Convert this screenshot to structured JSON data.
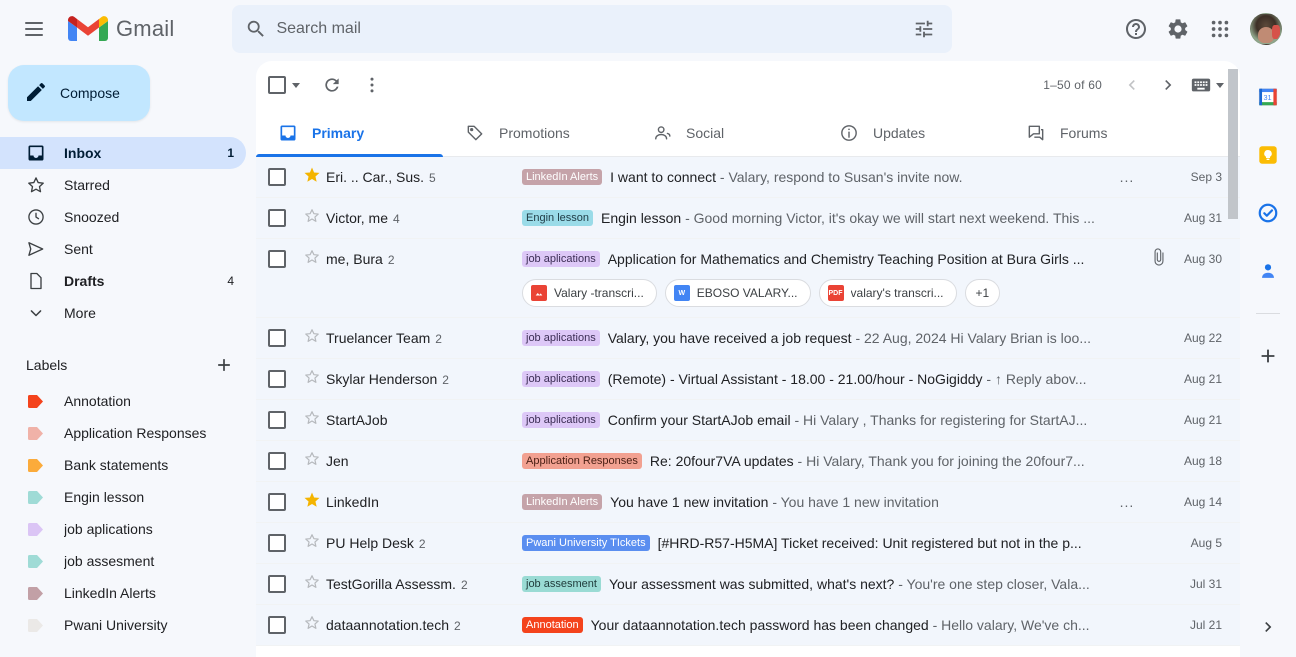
{
  "header": {
    "menu_icon": "hamburger-menu-icon",
    "brand": "Gmail",
    "search": {
      "placeholder": "Search mail",
      "value": "",
      "search_icon": "search-icon",
      "options_icon": "search-options-icon"
    },
    "support_icon": "help-icon",
    "settings_icon": "gear-icon",
    "apps_icon": "google-apps-grid-icon",
    "avatar_icon": "user-avatar"
  },
  "sidebar": {
    "compose": {
      "label": "Compose",
      "icon": "pencil-icon"
    },
    "items": [
      {
        "label": "Inbox",
        "icon": "inbox-icon",
        "count": "1",
        "active": true
      },
      {
        "label": "Starred",
        "icon": "star-icon",
        "count": "",
        "active": false
      },
      {
        "label": "Snoozed",
        "icon": "clock-icon",
        "count": "",
        "active": false
      },
      {
        "label": "Sent",
        "icon": "send-icon",
        "count": "",
        "active": false
      },
      {
        "label": "Drafts",
        "icon": "draft-file-icon",
        "count": "4",
        "active": false
      },
      {
        "label": "More",
        "icon": "chevron-down-icon",
        "count": "",
        "active": false
      }
    ],
    "labels_title": "Labels",
    "create_label_icon": "plus-icon",
    "labels": [
      {
        "label": "Annotation",
        "color": "#f4431c"
      },
      {
        "label": "Application Responses",
        "color": "#f0b2a8"
      },
      {
        "label": "Bank statements",
        "color": "#fbab3b"
      },
      {
        "label": "Engin lesson",
        "color": "#9fdbd6"
      },
      {
        "label": "job aplications",
        "color": "#dbc5f5"
      },
      {
        "label": "job assesment",
        "color": "#9fdbd6"
      },
      {
        "label": "LinkedIn Alerts",
        "color": "#c2a0a6"
      },
      {
        "label": "Pwani University",
        "color": "#ebe9e7"
      }
    ]
  },
  "toolbar": {
    "select_all_icon": "select-all-checkbox",
    "select_dropdown_icon": "chevron-down-icon",
    "refresh_icon": "refresh-icon",
    "more_icon": "more-vertical-icon",
    "page_range": "1–50 of 60",
    "prev_icon": "chevron-left-icon",
    "next_icon": "chevron-right-icon",
    "input_tools_icon": "keyboard-icon",
    "input_tools_caret": "chevron-down-icon"
  },
  "tabs": [
    {
      "label": "Primary",
      "icon": "inbox-tab-icon",
      "active": true
    },
    {
      "label": "Promotions",
      "icon": "tag-icon",
      "active": false
    },
    {
      "label": "Social",
      "icon": "people-icon",
      "active": false
    },
    {
      "label": "Updates",
      "icon": "info-icon",
      "active": false
    },
    {
      "label": "Forums",
      "icon": "forum-icon",
      "active": false
    }
  ],
  "emails": [
    {
      "sender": "Eri. .. Car., Sus.",
      "count": "5",
      "starred": true,
      "label": "LinkedIn Alerts",
      "label_bg": "#c5a3a9",
      "label_fg": "#ffffff",
      "subject": "I want to connect",
      "snippet": "- Valary, respond to Susan's invite now.",
      "ellipsis": "...",
      "attachment": false,
      "date": "Sep 3",
      "attachments": []
    },
    {
      "sender": "Victor, me",
      "count": "4",
      "starred": false,
      "label": "Engin lesson",
      "label_bg": "#9adbe8",
      "label_fg": "#1f3a44",
      "subject": "Engin lesson",
      "snippet": "- Good morning Victor, it's okay we will start next weekend. This ...",
      "ellipsis": "",
      "attachment": false,
      "date": "Aug 31",
      "attachments": []
    },
    {
      "sender": "me, Bura",
      "count": "2",
      "starred": false,
      "label": "job aplications",
      "label_bg": "#ddc8f7",
      "label_fg": "#3c2e55",
      "subject": "Application for Mathematics and Chemistry Teaching Position at Bura Girls ...",
      "snippet": "",
      "ellipsis": "",
      "attachment": true,
      "date": "Aug 30",
      "attachments": [
        {
          "name": "Valary -transcri...",
          "type": "image",
          "badge": "",
          "color": "#ea4335"
        },
        {
          "name": "EBOSO VALARY...",
          "type": "doc",
          "badge": "W",
          "color": "#4285f4"
        },
        {
          "name": "valary's transcri...",
          "type": "pdf",
          "badge": "PDF",
          "color": "#ea4335"
        }
      ],
      "attachments_more": "+1"
    },
    {
      "sender": "Truelancer Team",
      "count": "2",
      "starred": false,
      "label": "job aplications",
      "label_bg": "#ddc8f7",
      "label_fg": "#3c2e55",
      "subject": "Valary, you have received a job request",
      "snippet": "- 22 Aug, 2024 Hi Valary Brian is loo...",
      "ellipsis": "",
      "attachment": false,
      "date": "Aug 22",
      "attachments": []
    },
    {
      "sender": "Skylar Henderson",
      "count": "2",
      "starred": false,
      "label": "job aplications",
      "label_bg": "#ddc8f7",
      "label_fg": "#3c2e55",
      "subject": "(Remote) - Virtual Assistant - 18.00 - 21.00/hour - NoGigiddy",
      "snippet": "- ↑ Reply abov...",
      "ellipsis": "",
      "attachment": false,
      "date": "Aug 21",
      "attachments": []
    },
    {
      "sender": "StartAJob",
      "count": "",
      "starred": false,
      "label": "job aplications",
      "label_bg": "#ddc8f7",
      "label_fg": "#3c2e55",
      "subject": "Confirm your StartAJob email",
      "snippet": "- Hi Valary , Thanks for registering for StartAJ...",
      "ellipsis": "",
      "attachment": false,
      "date": "Aug 21",
      "attachments": []
    },
    {
      "sender": "Jen",
      "count": "",
      "starred": false,
      "label": "Application Responses",
      "label_bg": "#f2a191",
      "label_fg": "#4a1f14",
      "subject": "Re: 20four7VA updates",
      "snippet": "- Hi Valary, Thank you for joining the 20four7...",
      "ellipsis": "",
      "attachment": false,
      "date": "Aug 18",
      "attachments": []
    },
    {
      "sender": "LinkedIn",
      "count": "",
      "starred": true,
      "label": "LinkedIn Alerts",
      "label_bg": "#c5a3a9",
      "label_fg": "#ffffff",
      "subject": "You have 1 new invitation",
      "snippet": "- You have 1 new invitation",
      "ellipsis": "...",
      "attachment": false,
      "date": "Aug 14",
      "attachments": []
    },
    {
      "sender": "PU Help Desk",
      "count": "2",
      "starred": false,
      "label": "Pwani University TIckets",
      "label_bg": "#5a8ef0",
      "label_fg": "#ffffff",
      "subject": "[#HRD-R57-H5MA] Ticket received: Unit registered but not in the p...",
      "snippet": "",
      "ellipsis": "",
      "attachment": false,
      "date": "Aug 5",
      "attachments": []
    },
    {
      "sender": "TestGorilla Assessm.",
      "count": "2",
      "starred": false,
      "label": "job assesment",
      "label_bg": "#9adbd4",
      "label_fg": "#1f3a3a",
      "subject": "Your assessment was submitted, what's next?",
      "snippet": "- You're one step closer, Vala...",
      "ellipsis": "",
      "attachment": false,
      "date": "Jul 31",
      "attachments": []
    },
    {
      "sender": "dataannotation.tech",
      "count": "2",
      "starred": false,
      "label": "Annotation",
      "label_bg": "#f4431c",
      "label_fg": "#ffffff",
      "subject": "Your dataannotation.tech password has been changed",
      "snippet": "- Hello valary, We've ch...",
      "ellipsis": "",
      "attachment": false,
      "date": "Jul 21",
      "attachments": []
    }
  ],
  "rail": {
    "items": [
      {
        "icon": "google-calendar-icon",
        "name": "calendar"
      },
      {
        "icon": "google-keep-icon",
        "name": "keep"
      },
      {
        "icon": "google-tasks-icon",
        "name": "tasks"
      },
      {
        "icon": "google-contacts-icon",
        "name": "contacts"
      }
    ],
    "add_icon": "plus-icon",
    "expand_icon": "chevron-right-icon"
  }
}
